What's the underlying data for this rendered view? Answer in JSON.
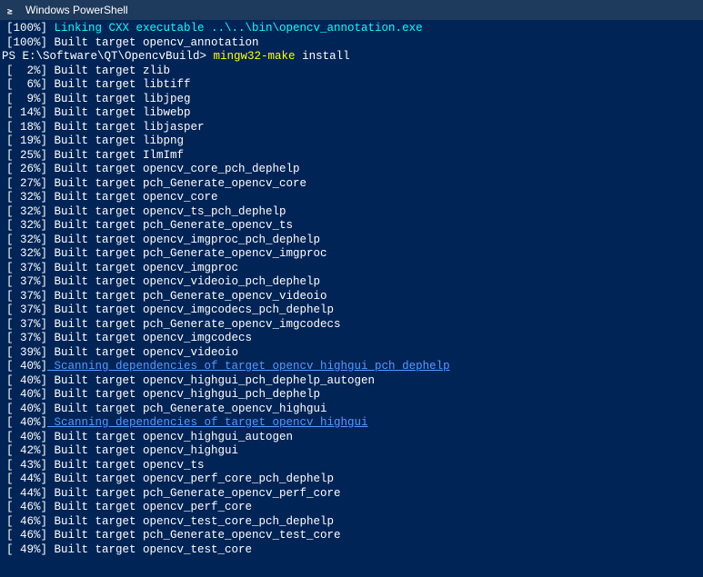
{
  "titleBar": {
    "icon": "powershell-icon",
    "title": "Windows PowerShell"
  },
  "terminal": {
    "lines": [
      {
        "percent": "100%",
        "type": "cyan",
        "text": "Linking CXX executable ..\\..\\bin\\opencv_annotation.exe"
      },
      {
        "percent": "100%",
        "type": "white",
        "text": "Built target opencv_annotation"
      },
      {
        "type": "prompt",
        "path": "PS E:\\Software\\QT\\OpencvBuild>",
        "cmd": " mingw32-make",
        "args": " install"
      },
      {
        "percent": "  2%",
        "type": "white",
        "text": "Built target zlib"
      },
      {
        "percent": "  6%",
        "type": "white",
        "text": "Built target libtiff"
      },
      {
        "percent": "  9%",
        "type": "white",
        "text": "Built target libjpeg"
      },
      {
        "percent": " 14%",
        "type": "white",
        "text": "Built target libwebp"
      },
      {
        "percent": " 18%",
        "type": "white",
        "text": "Built target libjasper"
      },
      {
        "percent": " 19%",
        "type": "white",
        "text": "Built target libpng"
      },
      {
        "percent": " 25%",
        "type": "white",
        "text": "Built target IlmImf"
      },
      {
        "percent": " 26%",
        "type": "white",
        "text": "Built target opencv_core_pch_dephelp"
      },
      {
        "percent": " 27%",
        "type": "white",
        "text": "Built target pch_Generate_opencv_core"
      },
      {
        "percent": " 32%",
        "type": "white",
        "text": "Built target opencv_core"
      },
      {
        "percent": " 32%",
        "type": "white",
        "text": "Built target opencv_ts_pch_dephelp"
      },
      {
        "percent": " 32%",
        "type": "white",
        "text": "Built target pch_Generate_opencv_ts"
      },
      {
        "percent": " 32%",
        "type": "white",
        "text": "Built target opencv_imgproc_pch_dephelp"
      },
      {
        "percent": " 32%",
        "type": "white",
        "text": "Built target pch_Generate_opencv_imgproc"
      },
      {
        "percent": " 37%",
        "type": "white",
        "text": "Built target opencv_imgproc"
      },
      {
        "percent": " 37%",
        "type": "white",
        "text": "Built target opencv_videoio_pch_dephelp"
      },
      {
        "percent": " 37%",
        "type": "white",
        "text": "Built target pch_Generate_opencv_videoio"
      },
      {
        "percent": " 37%",
        "type": "white",
        "text": "Built target opencv_imgcodecs_pch_dephelp"
      },
      {
        "percent": " 37%",
        "type": "white",
        "text": "Built target pch_Generate_opencv_imgcodecs"
      },
      {
        "percent": " 37%",
        "type": "white",
        "text": "Built target opencv_imgcodecs"
      },
      {
        "percent": " 39%",
        "type": "white",
        "text": "Built target opencv_videoio"
      },
      {
        "percent": " 40%",
        "type": "link",
        "text": "Scanning dependencies of target opencv_highgui_pch_dephelp"
      },
      {
        "percent": " 40%",
        "type": "white",
        "text": "Built target opencv_highgui_pch_dephelp_autogen"
      },
      {
        "percent": " 40%",
        "type": "white",
        "text": "Built target opencv_highgui_pch_dephelp"
      },
      {
        "percent": " 40%",
        "type": "white",
        "text": "Built target pch_Generate_opencv_highgui"
      },
      {
        "percent": " 40%",
        "type": "link",
        "text": "Scanning dependencies of target opencv_highgui"
      },
      {
        "percent": " 40%",
        "type": "white",
        "text": "Built target opencv_highgui_autogen"
      },
      {
        "percent": " 42%",
        "type": "white",
        "text": "Built target opencv_highgui"
      },
      {
        "percent": " 43%",
        "type": "white",
        "text": "Built target opencv_ts"
      },
      {
        "percent": " 44%",
        "type": "white",
        "text": "Built target opencv_perf_core_pch_dephelp"
      },
      {
        "percent": " 44%",
        "type": "white",
        "text": "Built target pch_Generate_opencv_perf_core"
      },
      {
        "percent": " 46%",
        "type": "white",
        "text": "Built target opencv_perf_core"
      },
      {
        "percent": " 46%",
        "type": "white",
        "text": "Built target opencv_test_core_pch_dephelp"
      },
      {
        "percent": " 46%",
        "type": "white",
        "text": "Built target pch_Generate_opencv_test_core"
      },
      {
        "percent": " 49%",
        "type": "white",
        "text": "Built target opencv_test_core"
      }
    ]
  }
}
